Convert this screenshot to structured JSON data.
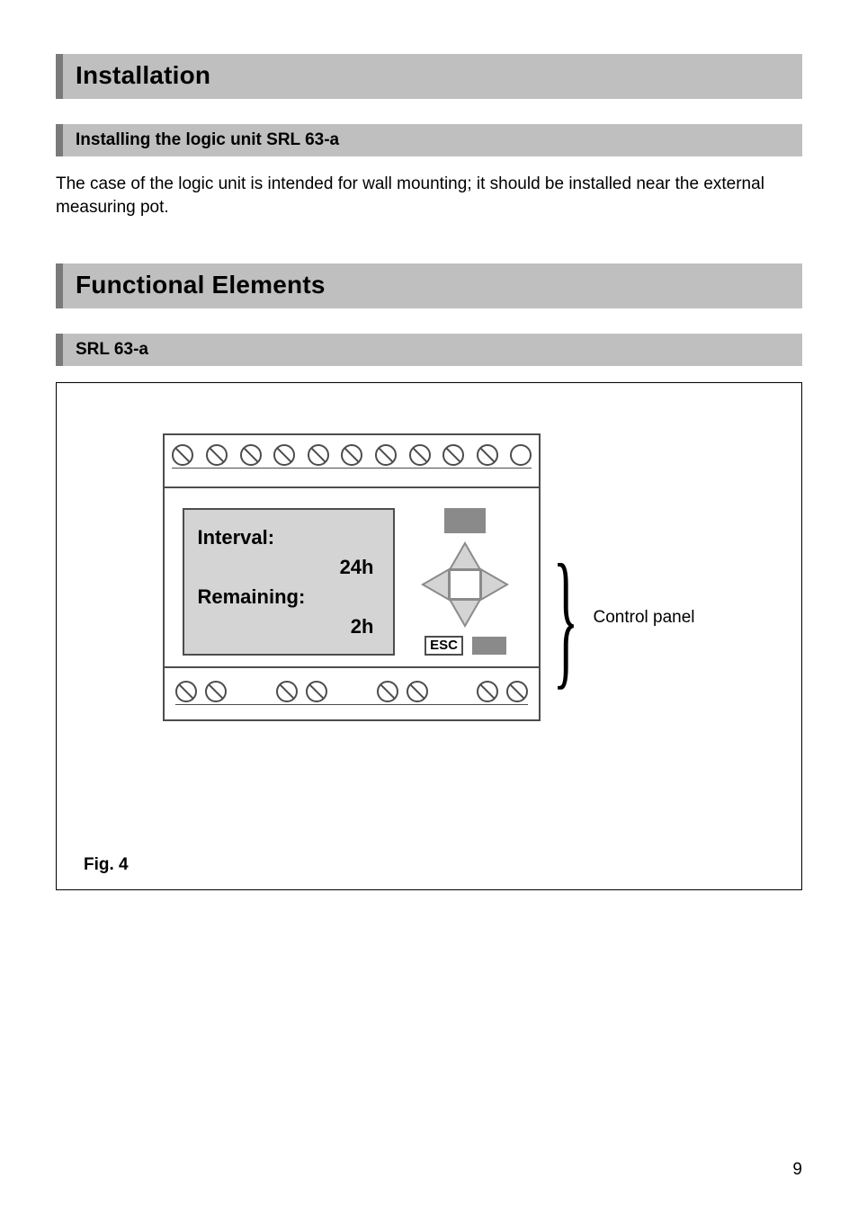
{
  "sections": {
    "installation": {
      "heading": "Installation",
      "sub": {
        "heading": "Installing the logic unit SRL 63-a",
        "body": "The case of the logic unit is intended for wall mounting; it should be installed near the external measuring pot."
      }
    },
    "functional": {
      "heading": "Functional Elements",
      "sub_heading": "SRL 63-a"
    }
  },
  "device": {
    "screen": {
      "line1_label": "Interval:",
      "line1_value": "24h",
      "line2_label": "Remaining:",
      "line2_value": "2h"
    },
    "buttons": {
      "esc_label": "ESC"
    },
    "top_terminals_count": 11,
    "bottom_terminal_pairs": 4
  },
  "callout": {
    "control_panel": "Control panel"
  },
  "figure_caption": "Fig. 4",
  "page_number": "9"
}
